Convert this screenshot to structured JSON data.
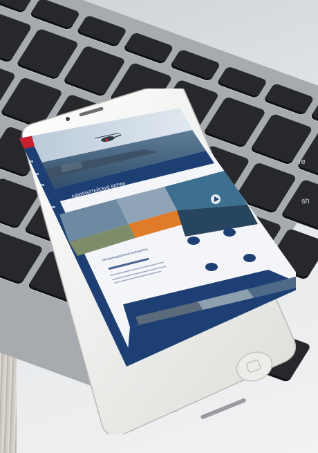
{
  "site": {
    "title": "АДМИРАЛТЕЙСКИЕ ВЕРФИ",
    "section_title": "ОРГАНИЗАЦИОННАЯ РАЗРАБОТКА"
  },
  "keyboard": {
    "visible_key_labels": [
      "re",
      "sh"
    ]
  },
  "colors": {
    "site_primary": "#1d3f73",
    "site_accent": "#c8202f",
    "phone_frame": "#f4f4f2",
    "keys": "#26282b"
  }
}
